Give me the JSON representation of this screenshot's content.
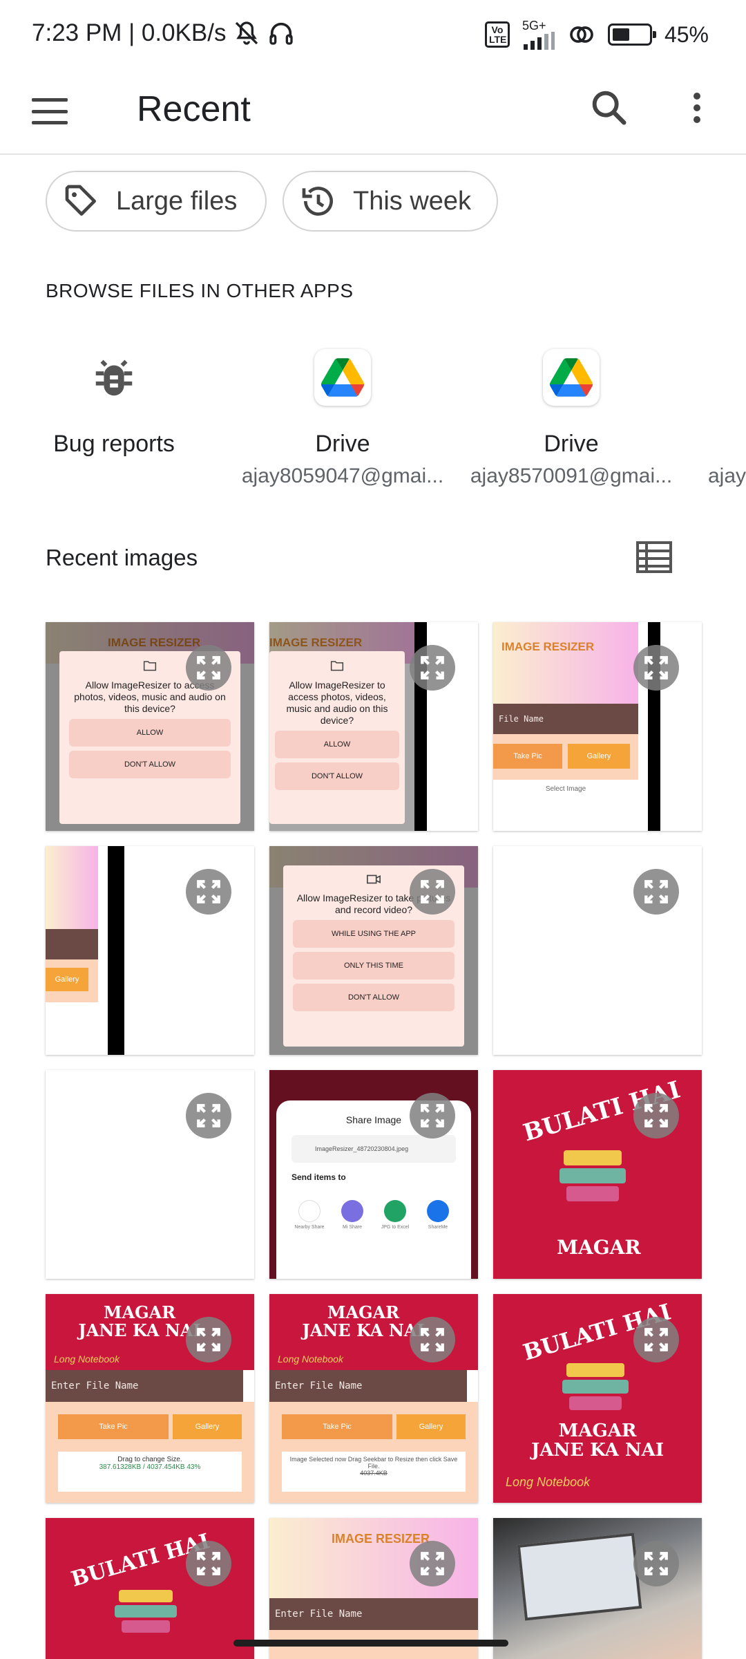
{
  "status_bar": {
    "time_speed": "7:23 PM | 0.0KB/s",
    "network": "5G+",
    "volte": "Vo LTE",
    "battery": "45%",
    "icons": [
      "mute-icon",
      "headphones-icon",
      "signal-icon",
      "hotspot-icon",
      "battery-icon"
    ]
  },
  "app_bar": {
    "title": "Recent",
    "icons": [
      "menu-icon",
      "search-icon",
      "more-vert-icon"
    ]
  },
  "chips": [
    {
      "label": "Large files",
      "icon": "tag-icon"
    },
    {
      "label": "This week",
      "icon": "history-icon"
    }
  ],
  "browse": {
    "heading": "BROWSE FILES IN OTHER APPS",
    "apps": [
      {
        "label": "Bug reports",
        "sub": "",
        "icon": "bug-icon"
      },
      {
        "label": "Drive",
        "sub": "ajay8059047@gmai...",
        "icon": "drive-icon"
      },
      {
        "label": "Drive",
        "sub": "ajay8570091@gmai...",
        "icon": "drive-icon"
      },
      {
        "label": "",
        "sub": "ajay",
        "icon": ""
      }
    ]
  },
  "recent_images": {
    "heading": "Recent images",
    "view_icon": "list-view-icon",
    "thumb_text": {
      "image_resizer": "IMAGE RESIZER",
      "allow_media": "Allow ImageResizer to access photos, videos, music and audio on this device?",
      "allow": "ALLOW",
      "dont_allow": "DON'T ALLOW",
      "file_name": "File Name",
      "take_pic": "Take Pic",
      "gallery": "Gallery",
      "select_image": "Select Image",
      "allow_camera": "Allow ImageResizer to take pictures and record video?",
      "while_using": "WHILE USING THE APP",
      "only_this_time": "ONLY THIS TIME",
      "share_image": "Share Image",
      "share_file": "ImageResizer_48720230804.jpeg",
      "send_items": "Send items to",
      "share_targets": [
        "Nearby Share",
        "Mi Share",
        "JPG to Excel",
        "ShareMe"
      ],
      "book_line1": "BULATI HAI",
      "book_line2": "MAGAR",
      "book_line3": "JANE KA NAI",
      "long_notebook": "Long Notebook",
      "enter_file_name": "Enter File Name",
      "drag_size": "Drag to change Size.",
      "size_value": "387.61328KB / 4037.454KB 43%",
      "selected_msg": "Image Selected now Drag Seekbar to Resize then click Save File.",
      "size_value_2": "4037.4KB"
    }
  },
  "colors": {
    "accent_text": "#202124",
    "chip_border": "#d3d3d3",
    "expand_overlay": "#808080",
    "book_red": "#c8163d",
    "brown_bar": "#6b4a45",
    "orange": "#f39a4a"
  }
}
